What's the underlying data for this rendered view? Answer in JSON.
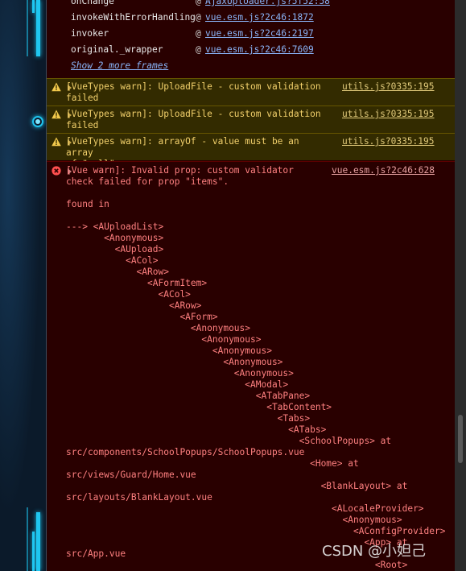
{
  "stack_frames": [
    {
      "fn": "onChange",
      "at": "@",
      "loc": "AjaxUploader.js?5f52:58"
    },
    {
      "fn": "invokeWithErrorHandling",
      "at": "@",
      "loc": "vue.esm.js?2c46:1872"
    },
    {
      "fn": "invoker",
      "at": "@",
      "loc": "vue.esm.js?2c46:2197"
    },
    {
      "fn": "original._wrapper",
      "at": "@",
      "loc": "vue.esm.js?2c46:7609"
    }
  ],
  "show_more_frames": "Show 2 more frames",
  "warnings": [
    {
      "message": "[VueTypes warn]: UploadFile - custom validation\nfailed",
      "source": "utils.js?0335:195"
    },
    {
      "message": "[VueTypes warn]: UploadFile - custom validation\nfailed",
      "source": "utils.js?0335:195"
    },
    {
      "message": "[VueTypes warn]: arrayOf - value must be an array\nof \"null\"",
      "source": "utils.js?0335:195"
    }
  ],
  "error": {
    "message": "[Vue warn]: Invalid prop: custom validator\ncheck failed for prop \"items\".",
    "source": "vue.esm.js?2c46:628",
    "trace": [
      "found in",
      "",
      "---> <AUploadList>",
      "       <Anonymous>",
      "         <AUpload>",
      "           <ACol>",
      "             <ARow>",
      "               <AFormItem>",
      "                 <ACol>",
      "                   <ARow>",
      "                     <AForm>",
      "                       <Anonymous>",
      "                         <Anonymous>",
      "                           <Anonymous>",
      "                             <Anonymous>",
      "                               <Anonymous>",
      "                                 <AModal>",
      "                                   <ATabPane>",
      "                                     <TabContent>",
      "                                       <Tabs>",
      "                                         <ATabs>",
      "                                           <SchoolPopups> at",
      "src/components/SchoolPopups/SchoolPopups.vue",
      "                                             <Home> at",
      "src/views/Guard/Home.vue",
      "                                               <BlankLayout> at",
      "src/layouts/BlankLayout.vue",
      "                                                 <ALocaleProvider>",
      "                                                   <Anonymous>",
      "                                                     <AConfigProvider>",
      "                                                       <App> at",
      "src/App.vue",
      "                                                         <Root>"
    ]
  },
  "watermark": "CSDN @小妲己",
  "colors": {
    "error_bg": "#290000",
    "warn_bg": "#332b00",
    "link": "#8ab4f8",
    "accent": "#1fc6f0"
  },
  "icons": {
    "warning": "warning-triangle-icon",
    "error": "error-circle-icon",
    "expand": "expand-triangle-icon"
  }
}
